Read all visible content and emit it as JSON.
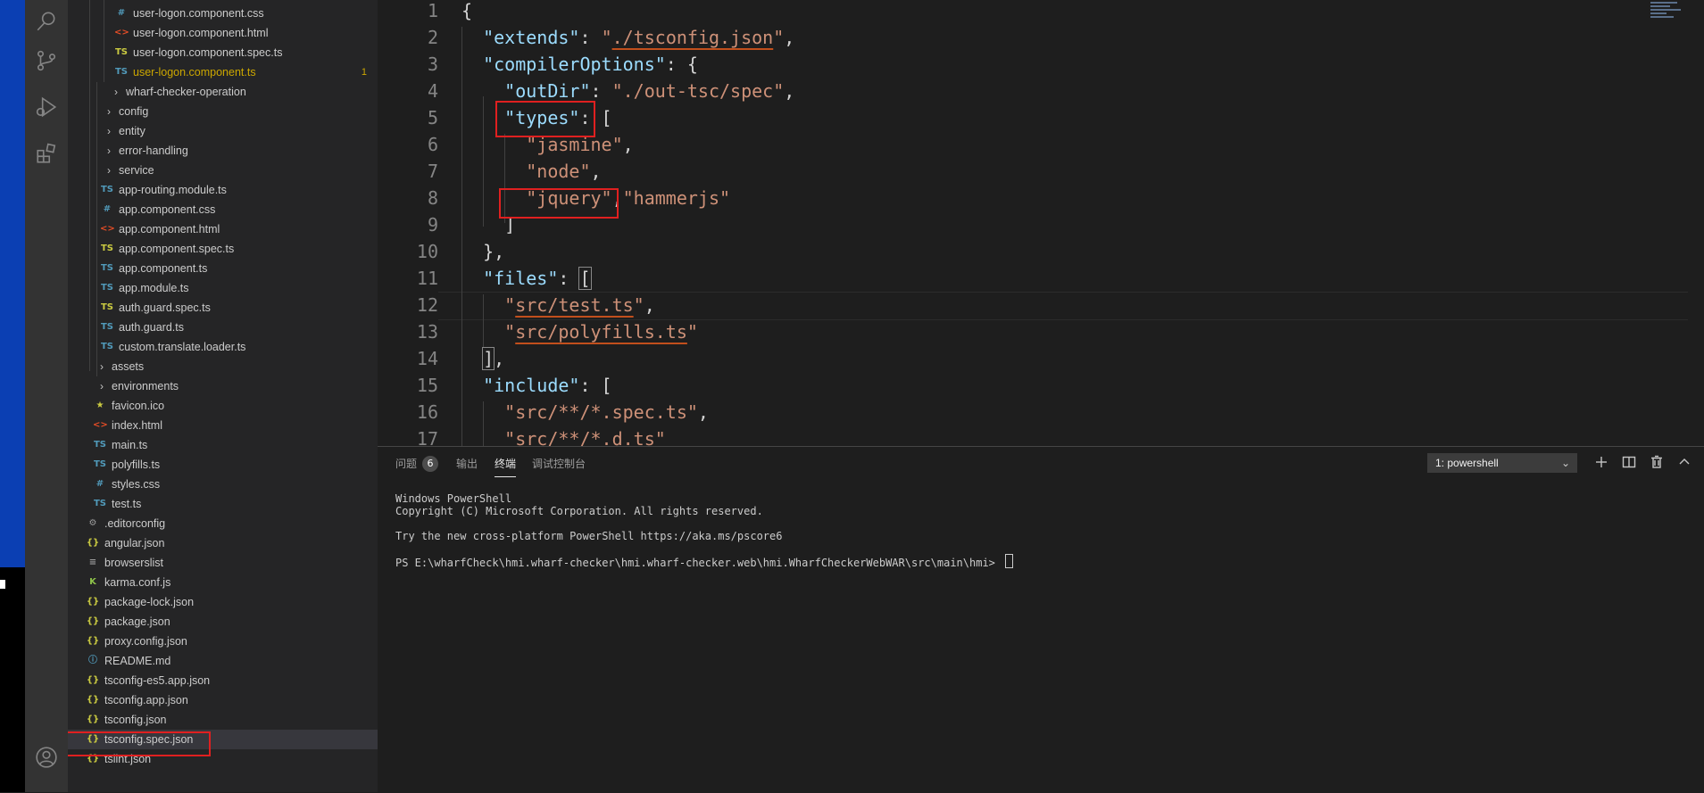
{
  "explorer": {
    "rows": [
      {
        "label": "user-logon.component.css",
        "icon": "#",
        "icon_color": "#519aba",
        "indent": 124,
        "chev": false
      },
      {
        "label": "user-logon.component.html",
        "icon": "<>",
        "icon_color": "#e44d26",
        "indent": 124,
        "chev": false
      },
      {
        "label": "user-logon.component.spec.ts",
        "icon": "TS",
        "icon_color": "#cbcb41",
        "indent": 124,
        "chev": false
      },
      {
        "label": "user-logon.component.ts",
        "icon": "TS",
        "icon_color": "#519aba",
        "indent": 124,
        "chev": false,
        "modified": true,
        "badge": "1"
      },
      {
        "label": "wharf-checker-operation",
        "icon": "",
        "indent": 116,
        "chev": true
      },
      {
        "label": "config",
        "icon": "",
        "indent": 108,
        "chev": true
      },
      {
        "label": "entity",
        "icon": "",
        "indent": 108,
        "chev": true
      },
      {
        "label": "error-handling",
        "icon": "",
        "indent": 108,
        "chev": true
      },
      {
        "label": "service",
        "icon": "",
        "indent": 108,
        "chev": true
      },
      {
        "label": "app-routing.module.ts",
        "icon": "TS",
        "icon_color": "#519aba",
        "indent": 108,
        "chev": false
      },
      {
        "label": "app.component.css",
        "icon": "#",
        "icon_color": "#519aba",
        "indent": 108,
        "chev": false
      },
      {
        "label": "app.component.html",
        "icon": "<>",
        "icon_color": "#e44d26",
        "indent": 108,
        "chev": false
      },
      {
        "label": "app.component.spec.ts",
        "icon": "TS",
        "icon_color": "#cbcb41",
        "indent": 108,
        "chev": false
      },
      {
        "label": "app.component.ts",
        "icon": "TS",
        "icon_color": "#519aba",
        "indent": 108,
        "chev": false
      },
      {
        "label": "app.module.ts",
        "icon": "TS",
        "icon_color": "#519aba",
        "indent": 108,
        "chev": false
      },
      {
        "label": "auth.guard.spec.ts",
        "icon": "TS",
        "icon_color": "#cbcb41",
        "indent": 108,
        "chev": false
      },
      {
        "label": "auth.guard.ts",
        "icon": "TS",
        "icon_color": "#519aba",
        "indent": 108,
        "chev": false
      },
      {
        "label": "custom.translate.loader.ts",
        "icon": "TS",
        "icon_color": "#519aba",
        "indent": 108,
        "chev": false
      },
      {
        "label": "assets",
        "icon": "",
        "indent": 100,
        "chev": true
      },
      {
        "label": "environments",
        "icon": "",
        "indent": 100,
        "chev": true
      },
      {
        "label": "favicon.ico",
        "icon": "★",
        "icon_color": "#cbcb41",
        "indent": 100,
        "chev": false
      },
      {
        "label": "index.html",
        "icon": "<>",
        "icon_color": "#e44d26",
        "indent": 100,
        "chev": false
      },
      {
        "label": "main.ts",
        "icon": "TS",
        "icon_color": "#519aba",
        "indent": 100,
        "chev": false
      },
      {
        "label": "polyfills.ts",
        "icon": "TS",
        "icon_color": "#519aba",
        "indent": 100,
        "chev": false
      },
      {
        "label": "styles.css",
        "icon": "#",
        "icon_color": "#519aba",
        "indent": 100,
        "chev": false
      },
      {
        "label": "test.ts",
        "icon": "TS",
        "icon_color": "#519aba",
        "indent": 100,
        "chev": false
      },
      {
        "label": ".editorconfig",
        "icon": "⚙",
        "icon_color": "#9d9d9d",
        "indent": 92,
        "chev": false
      },
      {
        "label": "angular.json",
        "icon": "{}",
        "icon_color": "#cbcb41",
        "indent": 92,
        "chev": false
      },
      {
        "label": "browserslist",
        "icon": "≡",
        "icon_color": "#9d9d9d",
        "indent": 92,
        "chev": false
      },
      {
        "label": "karma.conf.js",
        "icon": "K",
        "icon_color": "#8dc149",
        "indent": 92,
        "chev": false
      },
      {
        "label": "package-lock.json",
        "icon": "{}",
        "icon_color": "#cbcb41",
        "indent": 92,
        "chev": false
      },
      {
        "label": "package.json",
        "icon": "{}",
        "icon_color": "#cbcb41",
        "indent": 92,
        "chev": false
      },
      {
        "label": "proxy.config.json",
        "icon": "{}",
        "icon_color": "#cbcb41",
        "indent": 92,
        "chev": false
      },
      {
        "label": "README.md",
        "icon": "ⓘ",
        "icon_color": "#519aba",
        "indent": 92,
        "chev": false
      },
      {
        "label": "tsconfig-es5.app.json",
        "icon": "{}",
        "icon_color": "#cbcb41",
        "indent": 92,
        "chev": false
      },
      {
        "label": "tsconfig.app.json",
        "icon": "{}",
        "icon_color": "#cbcb41",
        "indent": 92,
        "chev": false
      },
      {
        "label": "tsconfig.json",
        "icon": "{}",
        "icon_color": "#cbcb41",
        "indent": 92,
        "chev": false
      },
      {
        "label": "tsconfig.spec.json",
        "icon": "{}",
        "icon_color": "#cbcb41",
        "indent": 92,
        "chev": false,
        "selected": true
      },
      {
        "label": "tslint.json",
        "icon": "{}",
        "icon_color": "#cbcb41",
        "indent": 92,
        "chev": false
      }
    ]
  },
  "editor": {
    "lines": [
      {
        "n": "1",
        "tokens": [
          [
            "p",
            "{"
          ]
        ]
      },
      {
        "n": "2",
        "tokens": [
          [
            "p",
            "  "
          ],
          [
            "k",
            "\"extends\""
          ],
          [
            "p",
            ": "
          ],
          [
            "s",
            "\""
          ],
          [
            "su",
            "./tsconfig.json"
          ],
          [
            "s",
            "\""
          ],
          [
            "p",
            ","
          ]
        ]
      },
      {
        "n": "3",
        "tokens": [
          [
            "p",
            "  "
          ],
          [
            "k",
            "\"compilerOptions\""
          ],
          [
            "p",
            ": {"
          ]
        ]
      },
      {
        "n": "4",
        "tokens": [
          [
            "p",
            "    "
          ],
          [
            "k",
            "\"outDir\""
          ],
          [
            "p",
            ": "
          ],
          [
            "s",
            "\"./out-tsc/spec\""
          ],
          [
            "p",
            ","
          ]
        ]
      },
      {
        "n": "5",
        "tokens": [
          [
            "p",
            "    "
          ],
          [
            "k",
            "\"types\""
          ],
          [
            "p",
            ": ["
          ]
        ]
      },
      {
        "n": "6",
        "tokens": [
          [
            "p",
            "      "
          ],
          [
            "s",
            "\"jasmine\""
          ],
          [
            "p",
            ","
          ]
        ]
      },
      {
        "n": "7",
        "tokens": [
          [
            "p",
            "      "
          ],
          [
            "s",
            "\"node\""
          ],
          [
            "p",
            ","
          ]
        ]
      },
      {
        "n": "8",
        "tokens": [
          [
            "p",
            "      "
          ],
          [
            "s",
            "\"jquery\""
          ],
          [
            "p",
            ","
          ],
          [
            "s",
            "\"hammerjs\""
          ]
        ]
      },
      {
        "n": "9",
        "tokens": [
          [
            "p",
            "    ]"
          ]
        ]
      },
      {
        "n": "10",
        "tokens": [
          [
            "p",
            "  },"
          ]
        ]
      },
      {
        "n": "11",
        "tokens": [
          [
            "p",
            "  "
          ],
          [
            "k",
            "\"files\""
          ],
          [
            "p",
            ": "
          ],
          [
            "pc",
            "["
          ]
        ]
      },
      {
        "n": "12",
        "tokens": [
          [
            "p",
            "    "
          ],
          [
            "s",
            "\""
          ],
          [
            "su",
            "src/test.ts"
          ],
          [
            "s",
            "\""
          ],
          [
            "p",
            ","
          ]
        ]
      },
      {
        "n": "13",
        "tokens": [
          [
            "p",
            "    "
          ],
          [
            "s",
            "\""
          ],
          [
            "su",
            "src/polyfills.ts"
          ],
          [
            "s",
            "\""
          ]
        ]
      },
      {
        "n": "14",
        "tokens": [
          [
            "p",
            "  "
          ],
          [
            "pc",
            "]"
          ],
          [
            "p",
            ","
          ]
        ]
      },
      {
        "n": "15",
        "tokens": [
          [
            "p",
            "  "
          ],
          [
            "k",
            "\"include\""
          ],
          [
            "p",
            ": ["
          ]
        ]
      },
      {
        "n": "16",
        "tokens": [
          [
            "p",
            "    "
          ],
          [
            "s",
            "\"src/**/*.spec.ts\""
          ],
          [
            "p",
            ","
          ]
        ]
      },
      {
        "n": "17",
        "tokens": [
          [
            "p",
            "    "
          ],
          [
            "s",
            "\"src/**/*.d.ts\""
          ]
        ]
      }
    ]
  },
  "panel": {
    "tabs": [
      {
        "label": "问题",
        "active": false
      },
      {
        "label": "输出",
        "active": false
      },
      {
        "label": "终端",
        "active": true
      },
      {
        "label": "调试控制台",
        "active": false
      }
    ],
    "problems_count": "6",
    "terminal_select": "1: powershell",
    "terminal_lines": [
      "Windows PowerShell",
      "Copyright (C) Microsoft Corporation. All rights reserved.",
      "",
      "Try the new cross-platform PowerShell https://aka.ms/pscore6",
      "",
      "PS E:\\wharfCheck\\hmi.wharf-checker\\hmi.wharf-checker.web\\hmi.WharfCheckerWebWAR\\src\\main\\hmi> "
    ]
  },
  "colors": {
    "keyword": "#9cdcfe",
    "string": "#ce9178",
    "punct": "#d4d4d4",
    "highlight_box": "#e02020",
    "modified": "#cca700"
  }
}
